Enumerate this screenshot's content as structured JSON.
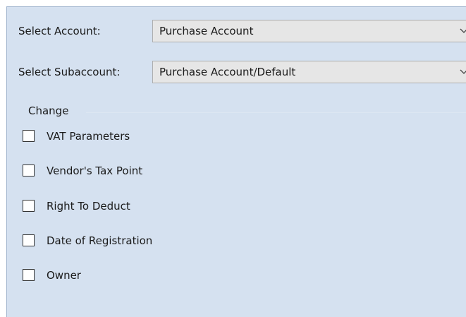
{
  "account": {
    "label": "Select Account:",
    "value": "Purchase Account"
  },
  "subaccount": {
    "label": "Select Subaccount:",
    "value": "Purchase Account/Default"
  },
  "change": {
    "title": "Change",
    "options": [
      {
        "label": "VAT Parameters",
        "checked": false
      },
      {
        "label": "Vendor's Tax Point",
        "checked": false
      },
      {
        "label": "Right To Deduct",
        "checked": false
      },
      {
        "label": "Date of Registration",
        "checked": false
      },
      {
        "label": "Owner",
        "checked": false
      }
    ]
  }
}
